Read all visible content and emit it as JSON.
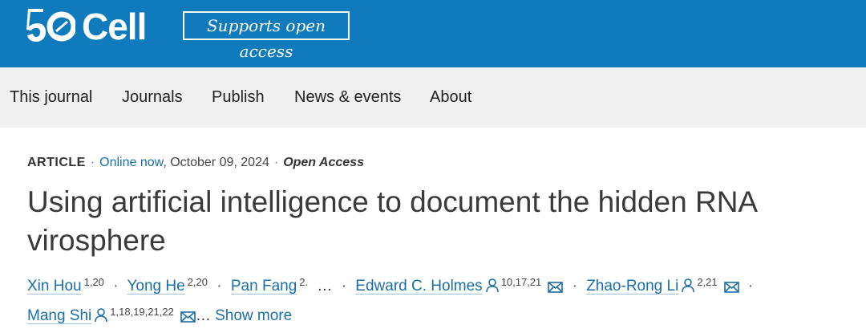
{
  "brand": {
    "logo_number": "50",
    "logo_name": "Cell",
    "open_access_badge": "Supports open access",
    "accent_color": "#0f7bbd",
    "link_color": "#1a6ea8"
  },
  "nav": {
    "items": [
      {
        "label": "This journal"
      },
      {
        "label": "Journals"
      },
      {
        "label": "Publish"
      },
      {
        "label": "News & events"
      },
      {
        "label": "About"
      }
    ]
  },
  "article": {
    "type": "ARTICLE",
    "status": "Online now",
    "date": ", October 09, 2024",
    "access": "Open Access",
    "title": "Using artificial intelligence to document the hidden RNA virosphere",
    "authors_line1": [
      {
        "name": "Xin Hou",
        "sup": "1,20"
      },
      {
        "name": "Yong He",
        "sup": "2,20"
      },
      {
        "name": "Pan Fang",
        "sup": "2."
      },
      {
        "name": "Edward C. Holmes",
        "sup": "10,17,21"
      },
      {
        "name": "Zhao-Rong Li",
        "sup": "2,21"
      }
    ],
    "authors_line2": [
      {
        "name": "Mang Shi",
        "sup": "1,18,19,21,22"
      }
    ],
    "ellipsis": "…",
    "separator": "·",
    "show_more": "Show more",
    "icons": [
      "person-icon",
      "envelope-icon"
    ]
  }
}
